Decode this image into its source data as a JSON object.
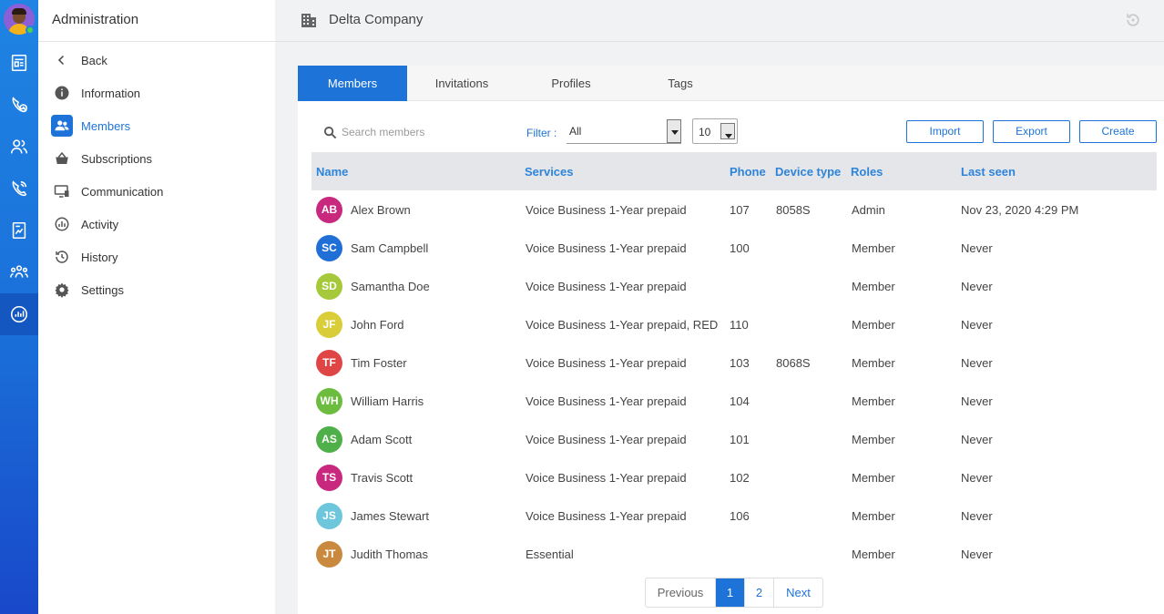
{
  "header": {
    "company_name": "Delta Company"
  },
  "admin_menu": {
    "title": "Administration",
    "items": [
      {
        "label": "Back",
        "icon": "chevron-left-icon"
      },
      {
        "label": "Information",
        "icon": "info-icon"
      },
      {
        "label": "Members",
        "icon": "members-icon",
        "active": true
      },
      {
        "label": "Subscriptions",
        "icon": "basket-icon"
      },
      {
        "label": "Communication",
        "icon": "monitor-icon"
      },
      {
        "label": "Activity",
        "icon": "activity-icon"
      },
      {
        "label": "History",
        "icon": "history-icon"
      },
      {
        "label": "Settings",
        "icon": "gear-icon"
      }
    ]
  },
  "rail_icons": [
    "news-icon",
    "phone-clock-icon",
    "contacts-icon",
    "phone-call-icon",
    "report-icon",
    "groups-icon",
    "analytics-icon"
  ],
  "tabs": [
    {
      "label": "Members",
      "active": true
    },
    {
      "label": "Invitations"
    },
    {
      "label": "Profiles"
    },
    {
      "label": "Tags"
    }
  ],
  "toolbar": {
    "search_placeholder": "Search members",
    "filter_label": "Filter :",
    "filter_value": "All",
    "page_size": "10",
    "import_label": "Import",
    "export_label": "Export",
    "create_label": "Create"
  },
  "table": {
    "columns": [
      "Name",
      "Services",
      "Phone",
      "Device type",
      "Roles",
      "Last seen"
    ],
    "rows": [
      {
        "initials": "AB",
        "color": "#c8297f",
        "name": "Alex Brown",
        "services": "Voice Business 1-Year prepaid",
        "phone": "107",
        "device": "8058S",
        "role": "Admin",
        "last_seen": "Nov 23, 2020 4:29 PM"
      },
      {
        "initials": "SC",
        "color": "#1f6fd6",
        "name": "Sam Campbell",
        "services": "Voice Business 1-Year prepaid",
        "phone": "100",
        "device": "",
        "role": "Member",
        "last_seen": "Never"
      },
      {
        "initials": "SD",
        "color": "#a5c93a",
        "name": "Samantha Doe",
        "services": "Voice Business 1-Year prepaid",
        "phone": "",
        "device": "",
        "role": "Member",
        "last_seen": "Never"
      },
      {
        "initials": "JF",
        "color": "#d9cd3a",
        "name": "John Ford",
        "services": "Voice Business 1-Year prepaid, RED",
        "phone": "110",
        "device": "",
        "role": "Member",
        "last_seen": "Never"
      },
      {
        "initials": "TF",
        "color": "#e04545",
        "name": "Tim Foster",
        "services": "Voice Business 1-Year prepaid",
        "phone": "103",
        "device": "8068S",
        "role": "Member",
        "last_seen": "Never"
      },
      {
        "initials": "WH",
        "color": "#6cbd3f",
        "name": "William Harris",
        "services": "Voice Business 1-Year prepaid",
        "phone": "104",
        "device": "",
        "role": "Member",
        "last_seen": "Never"
      },
      {
        "initials": "AS",
        "color": "#4fb04a",
        "name": "Adam Scott",
        "services": "Voice Business 1-Year prepaid",
        "phone": "101",
        "device": "",
        "role": "Member",
        "last_seen": "Never"
      },
      {
        "initials": "TS",
        "color": "#c8297f",
        "name": "Travis Scott",
        "services": "Voice Business 1-Year prepaid",
        "phone": "102",
        "device": "",
        "role": "Member",
        "last_seen": "Never"
      },
      {
        "initials": "JS",
        "color": "#6ec6dc",
        "name": "James Stewart",
        "services": "Voice Business 1-Year prepaid",
        "phone": "106",
        "device": "",
        "role": "Member",
        "last_seen": "Never"
      },
      {
        "initials": "JT",
        "color": "#c98a3f",
        "name": "Judith Thomas",
        "services": "Essential",
        "phone": "",
        "device": "",
        "role": "Member",
        "last_seen": "Never"
      }
    ]
  },
  "pagination": {
    "previous": "Previous",
    "pages": [
      "1",
      "2"
    ],
    "current": "1",
    "next": "Next"
  }
}
